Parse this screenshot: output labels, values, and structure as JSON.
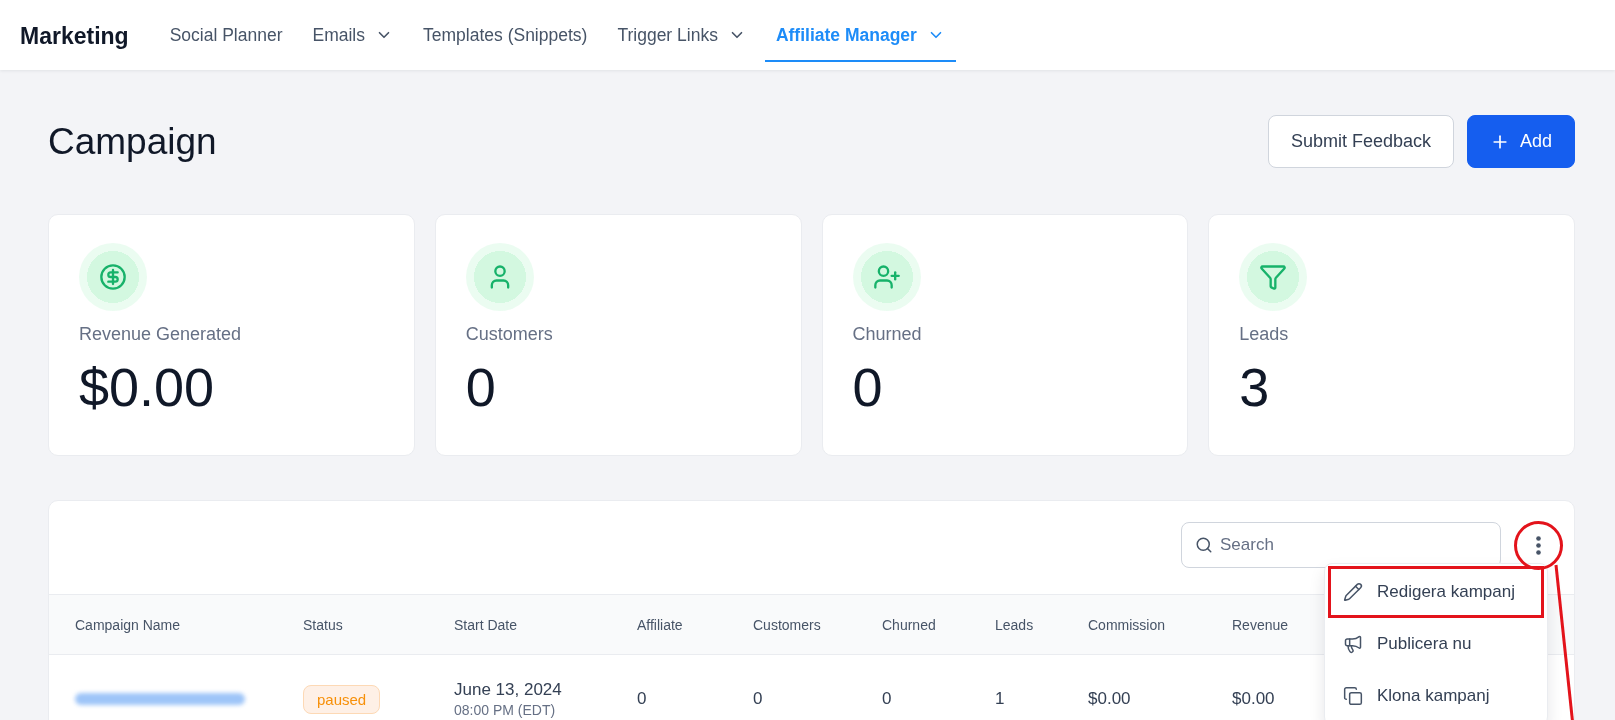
{
  "nav": {
    "brand": "Marketing",
    "items": [
      {
        "label": "Social Planner",
        "selected": false,
        "dropdown": false
      },
      {
        "label": "Emails",
        "selected": false,
        "dropdown": true
      },
      {
        "label": "Templates (Snippets)",
        "selected": false,
        "dropdown": false
      },
      {
        "label": "Trigger Links",
        "selected": false,
        "dropdown": true
      },
      {
        "label": "Affiliate Manager",
        "selected": true,
        "dropdown": true
      }
    ]
  },
  "header": {
    "title": "Campaign",
    "buttons": [
      {
        "label": "Submit Feedback",
        "kind": "secondary"
      },
      {
        "label": "Add",
        "kind": "primary"
      }
    ]
  },
  "stats": [
    {
      "kind": "revenue",
      "label": "Revenue Generated",
      "value": "$0.00"
    },
    {
      "kind": "customers",
      "label": "Customers",
      "value": "0"
    },
    {
      "kind": "churned",
      "label": "Churned",
      "value": "0"
    },
    {
      "kind": "leads",
      "label": "Leads",
      "value": "3"
    }
  ],
  "table": {
    "search": {
      "placeholder": "Search"
    },
    "actions_circled": true,
    "columns": [
      "Campaign Name",
      "Status",
      "Start Date",
      "Affiliate",
      "Customers",
      "Churned",
      "Leads",
      "Commission",
      "Revenue"
    ],
    "rows": [
      {
        "name_blurred": true,
        "status": "paused",
        "start_date": "June 13, 2024",
        "start_time": "08:00 PM (EDT)",
        "values": [
          "0",
          "0",
          "0",
          "1",
          "$0.00",
          "$0.00"
        ]
      }
    ]
  },
  "actions_menu": {
    "items": [
      {
        "kind": "edit",
        "label": "Redigera kampanj",
        "highlighted": true
      },
      {
        "kind": "publish",
        "label": "Publicera nu",
        "highlighted": false
      },
      {
        "kind": "clone",
        "label": "Klona kampanj",
        "highlighted": false
      }
    ]
  }
}
